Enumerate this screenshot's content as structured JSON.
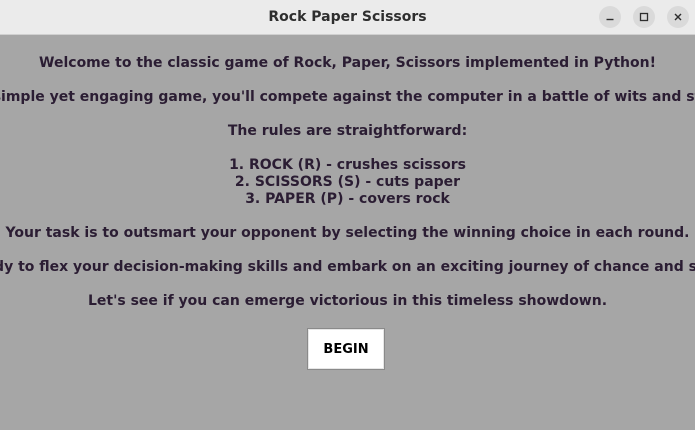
{
  "window": {
    "title": "Rock Paper Scissors"
  },
  "intro": {
    "lines": [
      "Welcome to the classic game of Rock, Paper, Scissors implemented in Python!",
      "In this simple yet engaging game, you'll compete against the computer in a battle of wits and strategy.",
      "The rules are straightforward:",
      "1. ROCK (R) - crushes scissors",
      "2. SCISSORS (S) - cuts paper",
      "3. PAPER (P) - covers rock",
      "Your task is to outsmart your opponent by selecting the winning choice in each round.",
      "Get ready to flex your decision-making skills and embark on an exciting journey of chance and strategy.",
      "Let's see if you can emerge victorious in this timeless showdown."
    ]
  },
  "begin_button": {
    "label": "BEGIN"
  },
  "colors": {
    "background": "#a6a6a6",
    "text": "#2b1d33",
    "titlebar": "#ebebeb",
    "button": "#ffffff"
  },
  "icons": {
    "minimize": "minimize-icon",
    "maximize": "maximize-icon",
    "close": "close-icon"
  }
}
